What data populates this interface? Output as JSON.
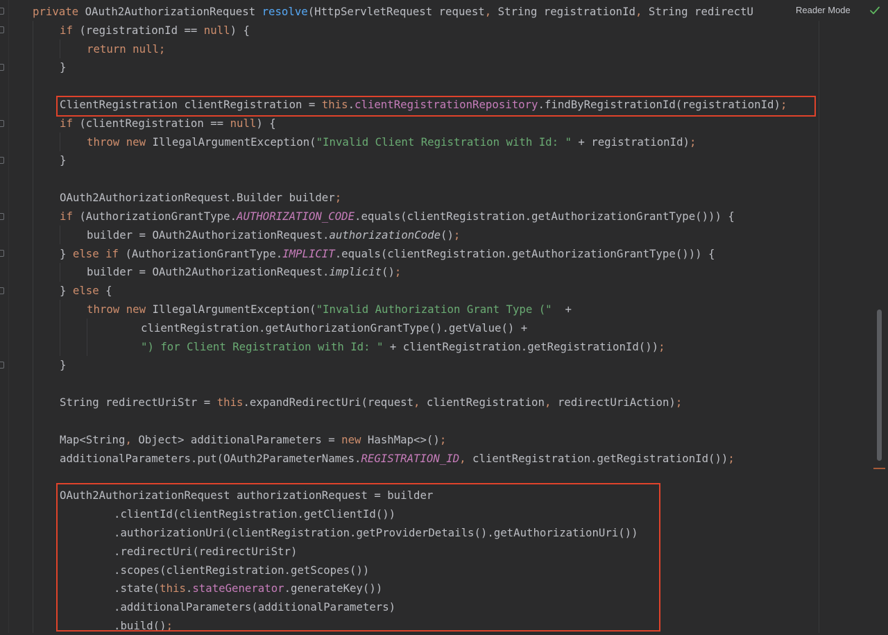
{
  "toolbar": {
    "reader_mode_label": "Reader Mode",
    "inspection_icon": "check-icon",
    "inspection_color": "#5fb860"
  },
  "code": {
    "l1": [
      "private",
      "OAuth2AuthorizationRequest",
      "resolve",
      "(HttpServletRequest request",
      ",",
      "String registrationId",
      ",",
      "String redirectU"
    ],
    "l2": [
      "if",
      "(registrationId == ",
      "null",
      ") {"
    ],
    "l3": [
      "return",
      "null",
      ";"
    ],
    "l4": [
      "}"
    ],
    "l6": [
      "ClientRegistration clientRegistration = ",
      "this",
      ".",
      "clientRegistrationRepository",
      ".findByRegistrationId(registrationId)",
      ";"
    ],
    "l7": [
      "if",
      "(clientRegistration == ",
      "null",
      ") {"
    ],
    "l8": [
      "throw",
      "new",
      "IllegalArgumentException(",
      "\"Invalid Client Registration with Id: \"",
      " + registrationId)",
      ";"
    ],
    "l9": [
      "}"
    ],
    "l11": [
      "OAuth2AuthorizationRequest.Builder builder",
      ";"
    ],
    "l12": [
      "if",
      "(AuthorizationGrantType.",
      "AUTHORIZATION_CODE",
      ".equals(clientRegistration.getAuthorizationGrantType())) {"
    ],
    "l13": [
      "builder = OAuth2AuthorizationRequest.",
      "authorizationCode",
      "()",
      ";"
    ],
    "l14": [
      "} ",
      "else if",
      " (AuthorizationGrantType.",
      "IMPLICIT",
      ".equals(clientRegistration.getAuthorizationGrantType())) {"
    ],
    "l15": [
      "builder = OAuth2AuthorizationRequest.",
      "implicit",
      "()",
      ";"
    ],
    "l16": [
      "} ",
      "else",
      " {"
    ],
    "l17": [
      "throw",
      "new",
      "IllegalArgumentException(",
      "\"Invalid Authorization Grant Type (\"",
      "  +"
    ],
    "l18": [
      "clientRegistration.getAuthorizationGrantType().getValue() +"
    ],
    "l19": [
      "\") for Client Registration with Id: \"",
      " + clientRegistration.getRegistrationId())",
      ";"
    ],
    "l20": [
      "}"
    ],
    "l22": [
      "String redirectUriStr = ",
      "this",
      ".expandRedirectUri(request",
      ",",
      " clientRegistration",
      ",",
      " redirectUriAction)",
      ";"
    ],
    "l24": [
      "Map<String",
      ",",
      " Object> additionalParameters = ",
      "new",
      " HashMap<>()",
      ";"
    ],
    "l25": [
      "additionalParameters.put(OAuth2ParameterNames.",
      "REGISTRATION_ID",
      ",",
      " clientRegistration.getRegistrationId())",
      ";"
    ],
    "l27": [
      "OAuth2AuthorizationRequest authorizationRequest = builder"
    ],
    "l28": [
      ".clientId(clientRegistration.getClientId())"
    ],
    "l29": [
      ".authorizationUri(clientRegistration.getProviderDetails().getAuthorizationUri())"
    ],
    "l30": [
      ".redirectUri(redirectUriStr)"
    ],
    "l31": [
      ".scopes(clientRegistration.getScopes())"
    ],
    "l32": [
      ".state(",
      "this",
      ".",
      "stateGenerator",
      ".generateKey())"
    ],
    "l33": [
      ".additionalParameters(additionalParameters)"
    ],
    "l34": [
      ".build()",
      ";"
    ]
  },
  "colors": {
    "keyword": "#cf8e6d",
    "method_decl": "#56a8f5",
    "field": "#c77dbb",
    "string": "#6aab73",
    "text": "#bcbec4",
    "highlight_box": "#e0432b"
  }
}
